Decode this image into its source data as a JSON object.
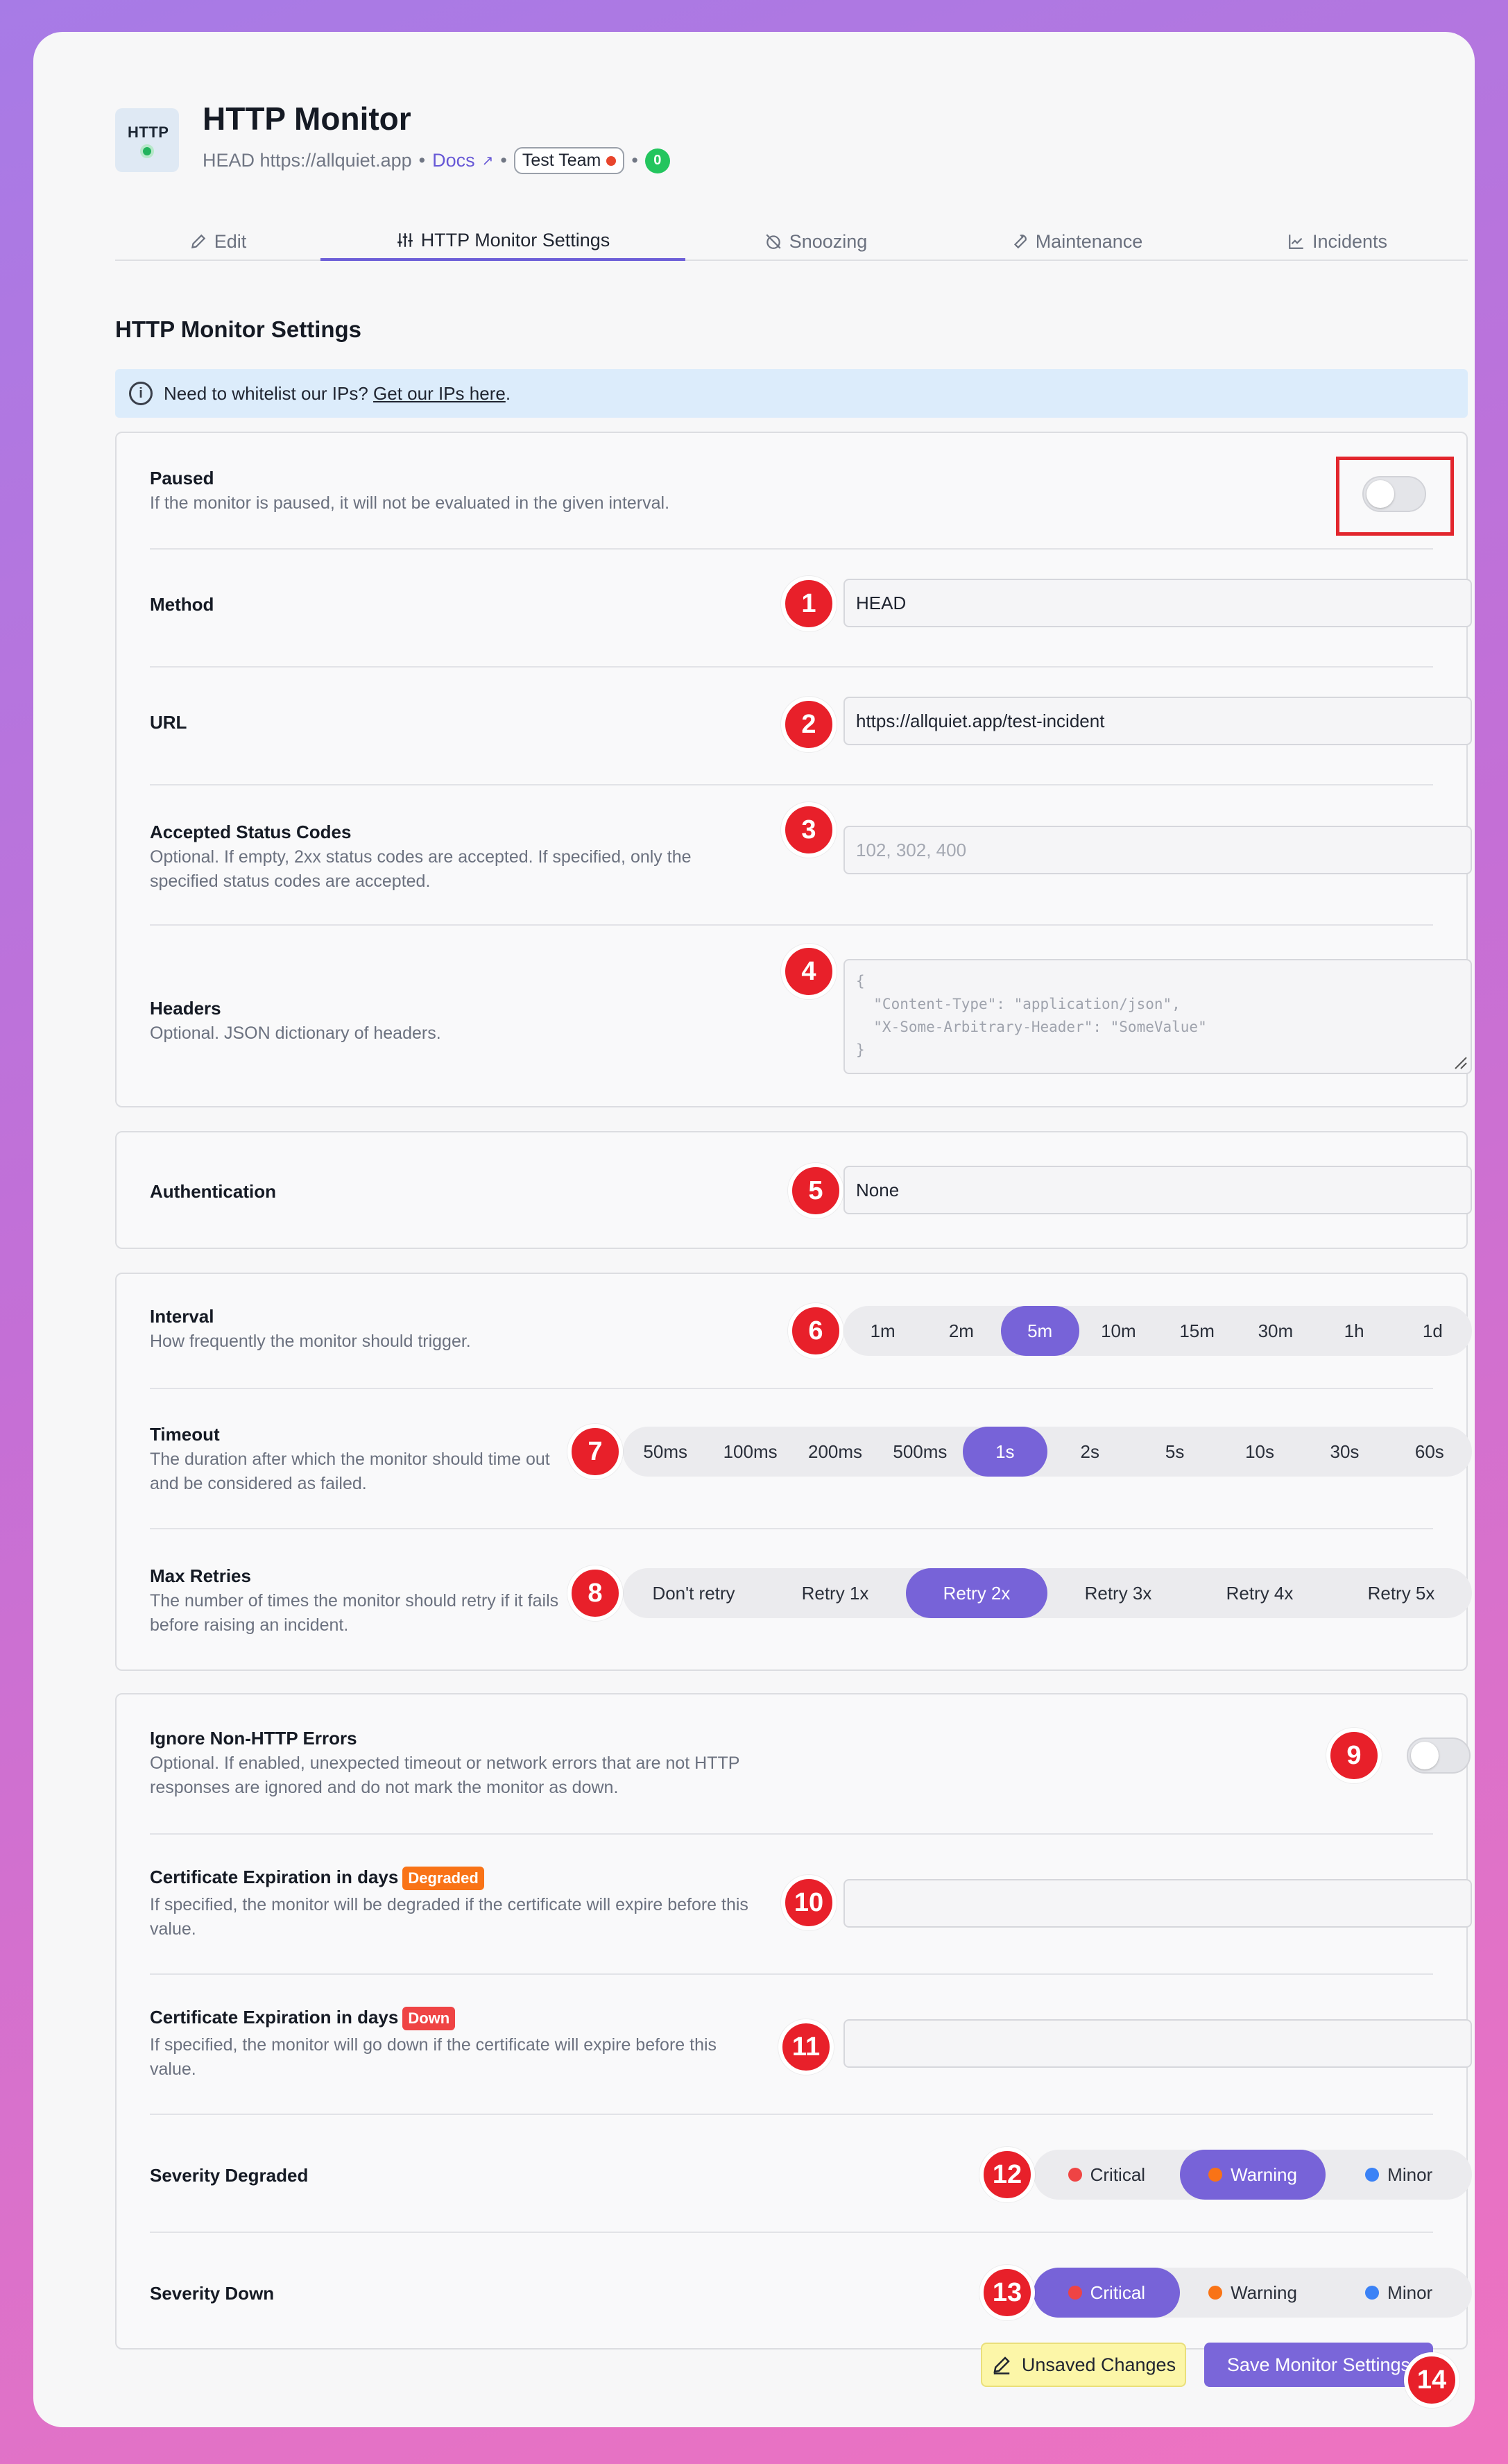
{
  "header": {
    "logo_text": "HTTP",
    "title": "HTTP Monitor",
    "subtitle_prefix": "HEAD https://allquiet.app",
    "bullet": "•",
    "docs_label": "Docs",
    "team_label": "Test Team",
    "count": "0"
  },
  "tabs": [
    {
      "label": "Edit",
      "icon": "pencil-icon"
    },
    {
      "label": "HTTP Monitor Settings",
      "icon": "sliders-icon"
    },
    {
      "label": "Snoozing",
      "icon": "snooze-icon"
    },
    {
      "label": "Maintenance",
      "icon": "wrench-icon"
    },
    {
      "label": "Incidents",
      "icon": "chart-icon"
    }
  ],
  "section_title": "HTTP Monitor Settings",
  "info": {
    "text": "Need to whitelist our IPs?",
    "link": "Get our IPs here",
    "suffix": "."
  },
  "paused": {
    "label": "Paused",
    "desc": "If the monitor is paused, it will not be evaluated in the given interval."
  },
  "method": {
    "label": "Method",
    "value": "HEAD"
  },
  "url": {
    "label": "URL",
    "value": "https://allquiet.app/test-incident"
  },
  "status_codes": {
    "label": "Accepted Status Codes",
    "desc": "Optional. If empty, 2xx status codes are accepted. If specified, only the specified status codes are accepted.",
    "placeholder": "102, 302, 400"
  },
  "headers": {
    "label": "Headers",
    "desc": "Optional. JSON dictionary of headers.",
    "placeholder": "{\n  \"Content-Type\": \"application/json\",\n  \"X-Some-Arbitrary-Header\": \"SomeValue\"\n}"
  },
  "authentication": {
    "label": "Authentication",
    "value": "None"
  },
  "interval": {
    "label": "Interval",
    "desc": "How frequently the monitor should trigger.",
    "options": [
      "1m",
      "2m",
      "5m",
      "10m",
      "15m",
      "30m",
      "1h",
      "1d"
    ],
    "selected": "5m"
  },
  "timeout": {
    "label": "Timeout",
    "desc": "The duration after which the monitor should time out and be considered as failed.",
    "options": [
      "50ms",
      "100ms",
      "200ms",
      "500ms",
      "1s",
      "2s",
      "5s",
      "10s",
      "30s",
      "60s"
    ],
    "selected": "1s"
  },
  "retries": {
    "label": "Max Retries",
    "desc": "The number of times the monitor should retry if it fails before raising an incident.",
    "options": [
      "Don't retry",
      "Retry 1x",
      "Retry 2x",
      "Retry 3x",
      "Retry 4x",
      "Retry 5x"
    ],
    "selected": "Retry 2x"
  },
  "ignore_errors": {
    "label": "Ignore Non-HTTP Errors",
    "desc": "Optional. If enabled, unexpected timeout or network errors that are not HTTP responses are ignored and do not mark the monitor as down."
  },
  "cert_degraded": {
    "label": "Certificate Expiration in days",
    "pill": "Degraded",
    "desc": "If specified, the monitor will be degraded if the certificate will expire before this value."
  },
  "cert_down": {
    "label": "Certificate Expiration in days",
    "pill": "Down",
    "desc": "If specified, the monitor will go down if the certificate will expire before this value."
  },
  "severity_degraded": {
    "label": "Severity Degraded",
    "options": [
      "Critical",
      "Warning",
      "Minor"
    ],
    "selected": "Warning"
  },
  "severity_down": {
    "label": "Severity Down",
    "options": [
      "Critical",
      "Warning",
      "Minor"
    ],
    "selected": "Critical"
  },
  "severity_colors": {
    "Critical": "#ef4444",
    "Warning": "#f97316",
    "Minor": "#3b82f6"
  },
  "colors": {
    "accent": "#7763d8",
    "degraded": "#f97316",
    "down": "#ef4444",
    "annotation": "#e8202a"
  },
  "markers": [
    "1",
    "2",
    "3",
    "4",
    "5",
    "6",
    "7",
    "8",
    "9",
    "10",
    "11",
    "12",
    "13",
    "14"
  ],
  "footer": {
    "unsaved": "Unsaved Changes",
    "save": "Save Monitor Settings"
  }
}
